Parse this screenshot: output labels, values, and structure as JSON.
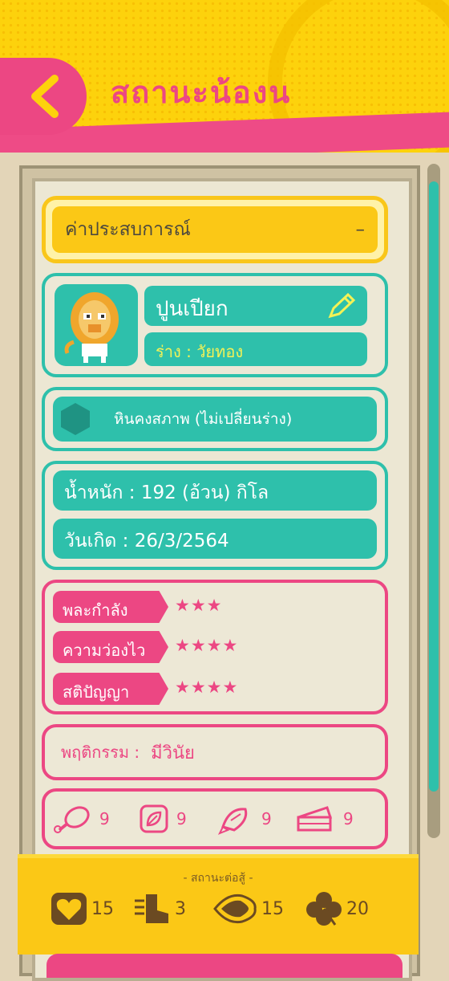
{
  "header": {
    "title": "สถานะน้องน"
  },
  "exp": {
    "label": "ค่าประสบการณ์",
    "toggle": "–"
  },
  "pet": {
    "name": "ปูนเปียก",
    "form": "ร่าง : วัยทอง"
  },
  "stone": {
    "label": "หินคงสภาพ (ไม่เปลี่ยนร่าง)"
  },
  "info": {
    "weight": "น้ำหนัก : 192 (อ้วน) กิโล",
    "birthday": "วันเกิด : 26/3/2564"
  },
  "stats": [
    {
      "label": "พละกำลัง",
      "stars": "★★★",
      "rating": 3
    },
    {
      "label": "ความว่องไว",
      "stars": "★★★★",
      "rating": 4
    },
    {
      "label": "สติปัญญา",
      "stars": "★★★★",
      "rating": 4
    }
  ],
  "behavior": {
    "label": "พฤติกรรม :",
    "value": "มีวินัย"
  },
  "items": [
    {
      "icon": "meat-icon",
      "count": "9"
    },
    {
      "icon": "leaf-icon",
      "count": "9"
    },
    {
      "icon": "fish-icon",
      "count": "9"
    },
    {
      "icon": "cake-icon",
      "count": "9"
    }
  ],
  "battle": {
    "title": "- สถานะต่อสู้ -",
    "stats": [
      {
        "icon": "heart-icon",
        "value": "15"
      },
      {
        "icon": "boot-icon",
        "value": "3"
      },
      {
        "icon": "eye-icon",
        "value": "15"
      },
      {
        "icon": "clover-icon",
        "value": "20"
      }
    ]
  },
  "colors": {
    "teal": "#2ec0ab",
    "pink": "#ec4783",
    "yellow": "#fbc816",
    "background": "#e3d5b8"
  }
}
